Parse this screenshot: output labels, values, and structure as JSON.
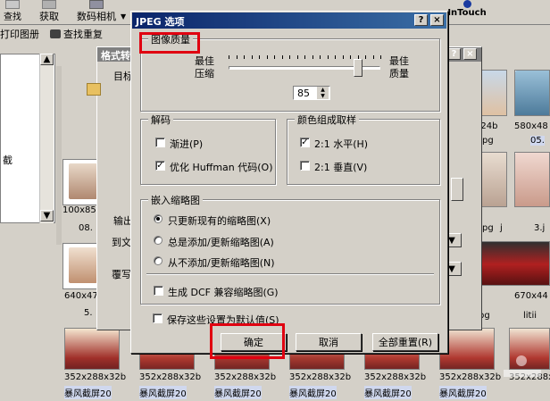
{
  "toolbar": {
    "top_items": [
      "查找",
      "获取",
      "数码相机",
      "InTouch"
    ],
    "second_items": [
      "打印图册",
      "查找重复"
    ]
  },
  "bg_dialog": {
    "title": "格式转",
    "target_label": "目标",
    "output_label": "输出",
    "to_label": "到文",
    "overwrite_label": "覆写"
  },
  "left_panel": {
    "text": "截"
  },
  "thumbnails": {
    "captions": [
      "100x85",
      "08.",
      "640x47",
      "5.",
      "352x288x32b",
      "352x288x32b",
      "352x288x32b",
      "352x288x32b",
      "352x288x32b",
      "352x288x32b",
      "352x288x32b",
      "暴风截屏20",
      "暴风截屏20",
      "暴风截屏20",
      "暴风截屏20",
      "暴风截屏20",
      "暴风截屏20",
      "324b",
      "580x48",
      "05.",
      "pg",
      "j",
      "pg",
      "3.j",
      "670x44",
      "litii",
      "pg"
    ]
  },
  "dialog": {
    "title": "JPEG 选项",
    "help_glyph": "?",
    "close_glyph": "×",
    "quality": {
      "group_title": "图像质量",
      "left_label_1": "最佳",
      "left_label_2": "压缩",
      "right_label_1": "最佳",
      "right_label_2": "质量",
      "value": "85",
      "slider_fraction": 0.85
    },
    "decode": {
      "group_title": "解码",
      "progressive": "渐进(P)",
      "progressive_checked": false,
      "optimize": "优化 Huffman 代码(O)",
      "optimize_checked": true
    },
    "color": {
      "group_title": "颜色组成取样",
      "horizontal": "2:1 水平(H)",
      "horizontal_checked": true,
      "vertical": "2:1 垂直(V)",
      "vertical_checked": false
    },
    "embed": {
      "group_title": "嵌入缩略图",
      "opt1": "只更新现有的缩略图(X)",
      "opt2": "总是添加/更新缩略图(A)",
      "opt3": "从不添加/更新缩略图(N)",
      "selected": 0,
      "dcf": "生成 DCF 兼容缩略图(G)",
      "dcf_checked": false
    },
    "save_default": "保存这些设置为默认值(S)",
    "save_default_checked": false,
    "buttons": {
      "ok": "确定",
      "cancel": "取消",
      "reset": "全部重置(R)"
    }
  },
  "colors": {
    "highlight": "#e00010",
    "titlebar": "#0a246a"
  }
}
